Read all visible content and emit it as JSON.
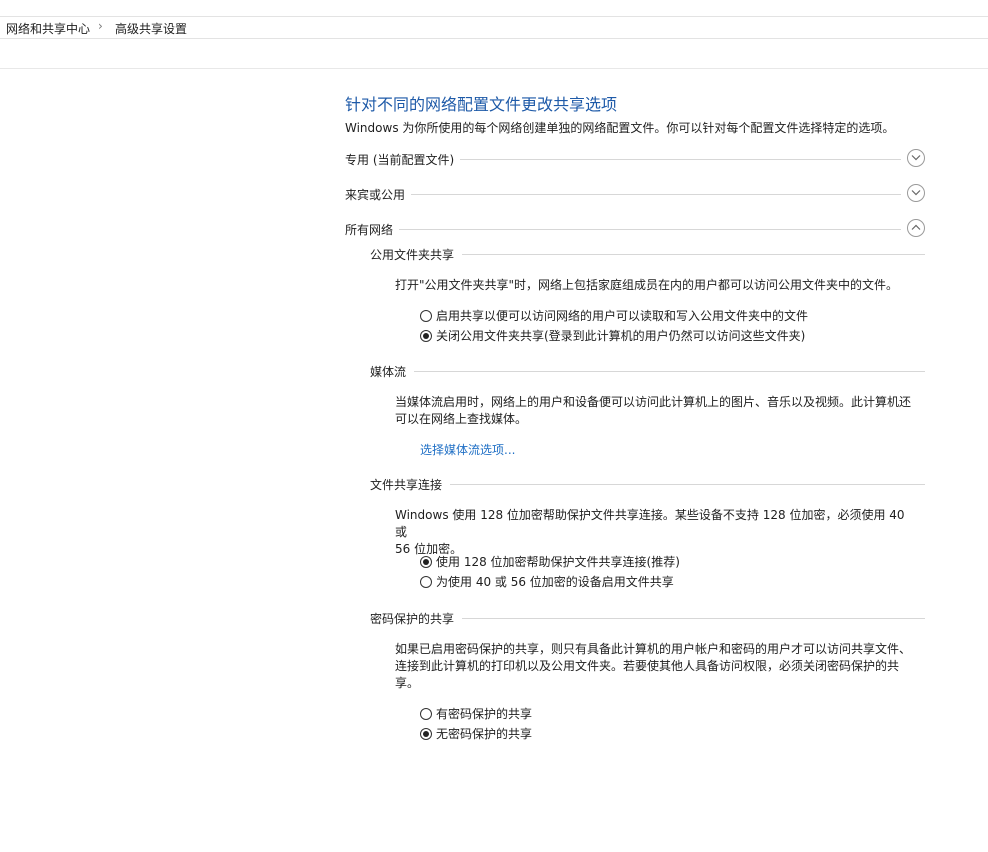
{
  "breadcrumb": {
    "items": [
      "网络和共享中心",
      "高级共享设置"
    ],
    "separator": "›"
  },
  "page": {
    "title": "针对不同的网络配置文件更改共享选项",
    "description": "Windows 为你所使用的每个网络创建单独的网络配置文件。你可以针对每个配置文件选择特定的选项。"
  },
  "profiles": [
    {
      "label": "专用 (当前配置文件)",
      "state": "collapsed"
    },
    {
      "label": "来宾或公用",
      "state": "collapsed"
    },
    {
      "label": "所有网络",
      "state": "expanded"
    }
  ],
  "all_networks": {
    "public_folder": {
      "heading": "公用文件夹共享",
      "text": "打开\"公用文件夹共享\"时，网络上包括家庭组成员在内的用户都可以访问公用文件夹中的文件。",
      "options": [
        {
          "label": "启用共享以便可以访问网络的用户可以读取和写入公用文件夹中的文件",
          "selected": false
        },
        {
          "label": "关闭公用文件夹共享(登录到此计算机的用户仍然可以访问这些文件夹)",
          "selected": true
        }
      ]
    },
    "media": {
      "heading": "媒体流",
      "text_line1": "当媒体流启用时，网络上的用户和设备便可以访问此计算机上的图片、音乐以及视频。此计算机还",
      "text_line2": "可以在网络上查找媒体。",
      "link": "选择媒体流选项..."
    },
    "file_sharing": {
      "heading": "文件共享连接",
      "text_line1": "Windows 使用 128 位加密帮助保护文件共享连接。某些设备不支持 128 位加密，必须使用 40 或",
      "text_line2": "56 位加密。",
      "options": [
        {
          "label": "使用 128 位加密帮助保护文件共享连接(推荐)",
          "selected": true
        },
        {
          "label": "为使用 40 或 56 位加密的设备启用文件共享",
          "selected": false
        }
      ]
    },
    "password": {
      "heading": "密码保护的共享",
      "text_line1": "如果已启用密码保护的共享，则只有具备此计算机的用户帐户和密码的用户才可以访问共享文件、",
      "text_line2": "连接到此计算机的打印机以及公用文件夹。若要使其他人具备访问权限，必须关闭密码保护的共",
      "text_line3": "享。",
      "options": [
        {
          "label": "有密码保护的共享",
          "selected": false
        },
        {
          "label": "无密码保护的共享",
          "selected": true
        }
      ]
    }
  }
}
